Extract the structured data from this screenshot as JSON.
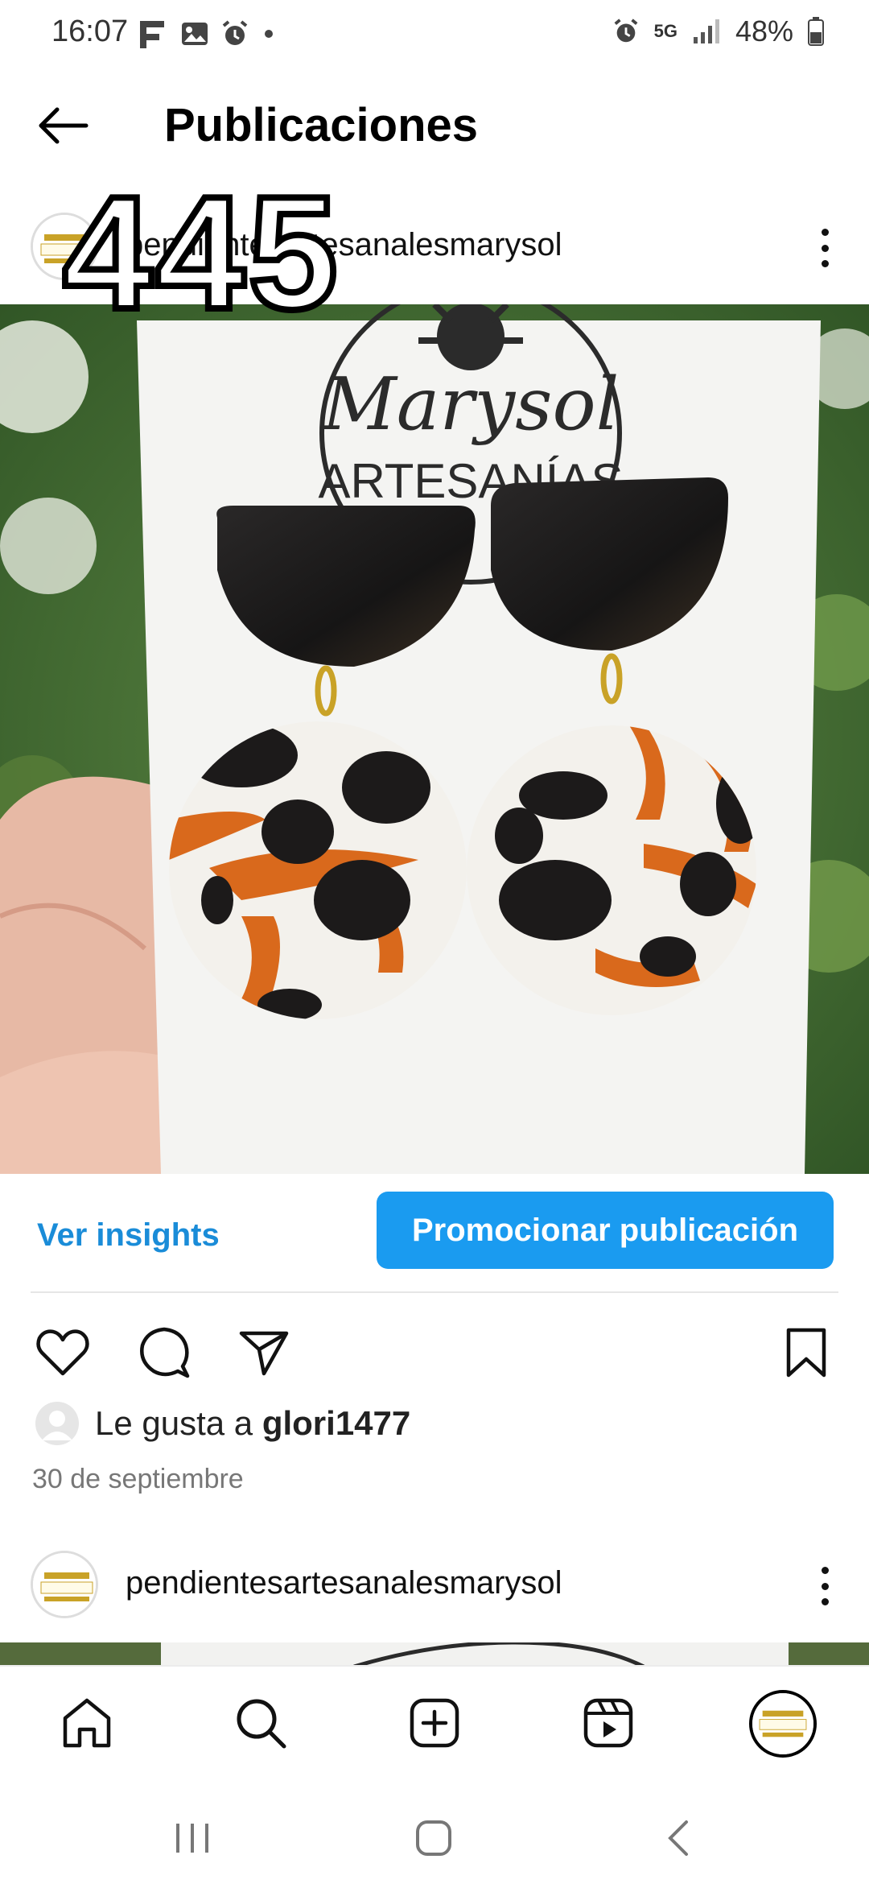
{
  "status_bar": {
    "time": "16:07",
    "network": "5G",
    "battery": "48%",
    "left_icons": [
      "flipboard-icon",
      "image-icon",
      "alarm-icon",
      "dot-icon"
    ],
    "right_icons": [
      "alarm-icon",
      "5g-icon",
      "signal-icon",
      "battery-icon"
    ]
  },
  "header": {
    "title": "Publicaciones",
    "back_icon": "arrow-left-icon"
  },
  "post": {
    "username": "pendientesartesanalesmarysol",
    "overlay_count": "445",
    "image_logo_text_top": "Marysol",
    "image_logo_text_bottom": "ARTESANÍAS",
    "insights_label": "Ver insights",
    "promote_label": "Promocionar publicación",
    "likes_prefix": "Le gusta a ",
    "likes_user": "glori1477",
    "date": "30 de septiembre"
  },
  "next_post": {
    "username": "pendientesartesanalesmarysol"
  },
  "colors": {
    "accent": "#1a9bf0",
    "link": "#1a8cd8",
    "earring_black": "#1c1a1a",
    "earring_orange": "#d9691c",
    "card_white": "#f4f4f2",
    "foliage": "#3d6b2e"
  },
  "nav": [
    "home-icon",
    "search-icon",
    "add-post-icon",
    "reels-icon",
    "profile-avatar"
  ],
  "system_nav": [
    "recents-icon",
    "home-button-icon",
    "back-icon"
  ]
}
